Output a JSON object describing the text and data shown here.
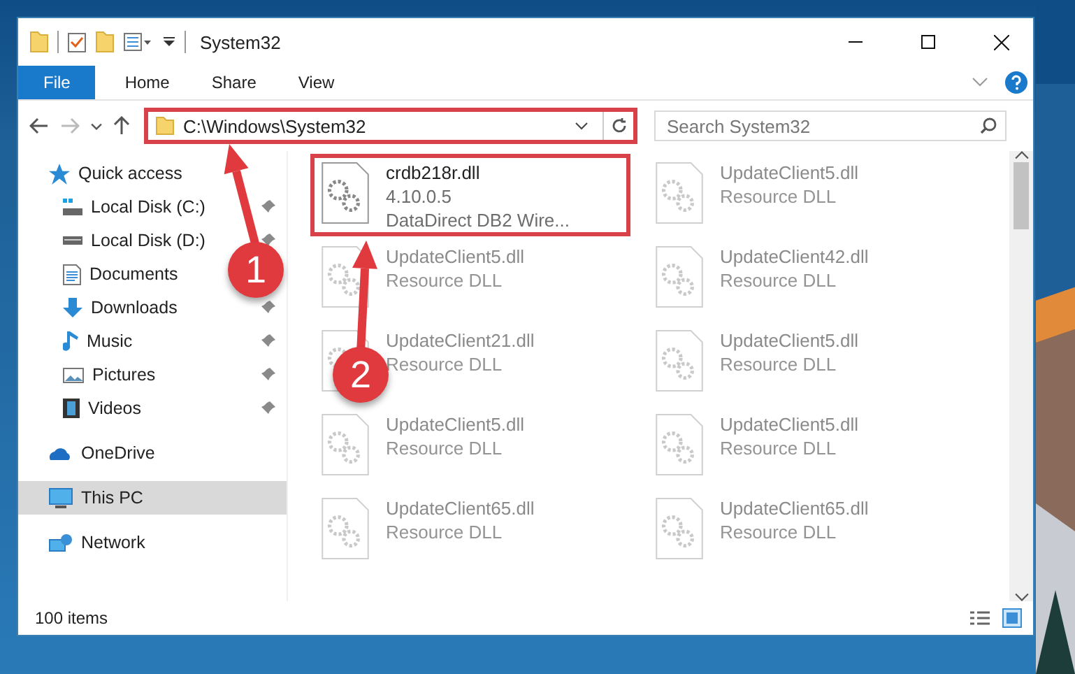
{
  "window": {
    "title": "System32"
  },
  "ribbon": {
    "tabs": [
      {
        "label": "File",
        "kind": "file"
      },
      {
        "label": "Home",
        "kind": "tab"
      },
      {
        "label": "Share",
        "kind": "tab"
      },
      {
        "label": "View",
        "kind": "tab"
      }
    ]
  },
  "address_bar": {
    "path": "C:\\Windows\\System32",
    "highlighted": true
  },
  "search": {
    "placeholder": "Search System32"
  },
  "navigation": [
    {
      "label": "Quick access",
      "selected": false,
      "children": [
        {
          "label": "Local Disk (C:)",
          "pinned": true
        },
        {
          "label": "Local Disk (D:)",
          "pinned": true
        },
        {
          "label": "Documents"
        },
        {
          "label": "Downloads",
          "pinned": true
        },
        {
          "label": "Music",
          "pinned": true
        },
        {
          "label": "Pictures",
          "pinned": true
        },
        {
          "label": "Videos",
          "pinned": true
        }
      ]
    },
    {
      "label": "OneDrive",
      "selected": false
    },
    {
      "label": "This PC",
      "selected": true
    },
    {
      "label": "Network",
      "selected": false
    }
  ],
  "files": [
    {
      "name": "crdb218r.dll",
      "lines": [
        "4.10.0.5",
        "DataDirect DB2 Wire..."
      ],
      "faded": false,
      "highlighted": true
    },
    {
      "name": "UpdateClient5.dll",
      "lines": [
        "Resource DLL"
      ],
      "faded": true,
      "highlighted": false
    },
    {
      "name": "UpdateClient5.dll",
      "lines": [
        "Resource DLL"
      ],
      "faded": true,
      "highlighted": false
    },
    {
      "name": "UpdateClient42.dll",
      "lines": [
        "Resource DLL"
      ],
      "faded": true,
      "highlighted": false
    },
    {
      "name": "UpdateClient21.dll",
      "lines": [
        "Resource DLL"
      ],
      "faded": true,
      "highlighted": false
    },
    {
      "name": "UpdateClient5.dll",
      "lines": [
        "Resource DLL"
      ],
      "faded": true,
      "highlighted": false
    },
    {
      "name": "UpdateClient5.dll",
      "lines": [
        "Resource DLL"
      ],
      "faded": true,
      "highlighted": false
    },
    {
      "name": "UpdateClient5.dll",
      "lines": [
        "Resource DLL"
      ],
      "faded": true,
      "highlighted": false
    },
    {
      "name": "UpdateClient65.dll",
      "lines": [
        "Resource DLL"
      ],
      "faded": true,
      "highlighted": false
    },
    {
      "name": "UpdateClient65.dll",
      "lines": [
        "Resource DLL"
      ],
      "faded": true,
      "highlighted": false
    }
  ],
  "status_bar": {
    "item_count": "100 items"
  },
  "callouts": [
    {
      "number": "1"
    },
    {
      "number": "2"
    }
  ]
}
